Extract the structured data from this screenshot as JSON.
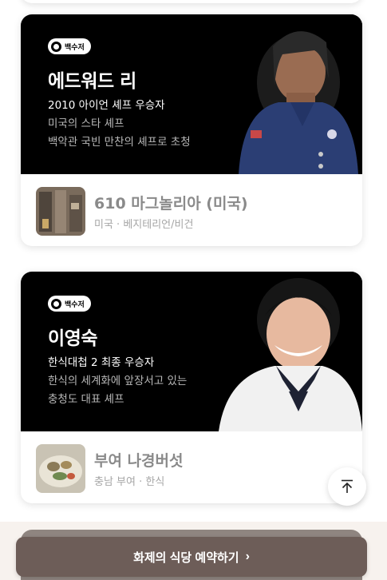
{
  "cards": [
    {
      "badge": "백수저",
      "chef_name": "에드워드 리",
      "desc_1": "2010 아이언 셰프 우승자",
      "desc_2": "미국의 스타 셰프",
      "desc_3": "백악관 국빈 만찬의 셰프로 초청",
      "restaurant_name": "610 마그놀리아 (미국)",
      "restaurant_meta": "미국 · 베지테리언/비건"
    },
    {
      "badge": "백수저",
      "chef_name": "이영숙",
      "desc_1": "한식대첩 2 최종 우승자",
      "desc_2": "한식의 세계화에 앞장서고 있는",
      "desc_3": "충청도 대표 셰프",
      "restaurant_name": "부여 나경버섯",
      "restaurant_meta": "충남 부여 · 한식"
    }
  ],
  "cta": {
    "label": "화제의 식당 예약하기",
    "chevron": "›"
  },
  "icons": {
    "scroll_top": "arrow-up-to-line-icon",
    "badge": "spoon-icon"
  }
}
